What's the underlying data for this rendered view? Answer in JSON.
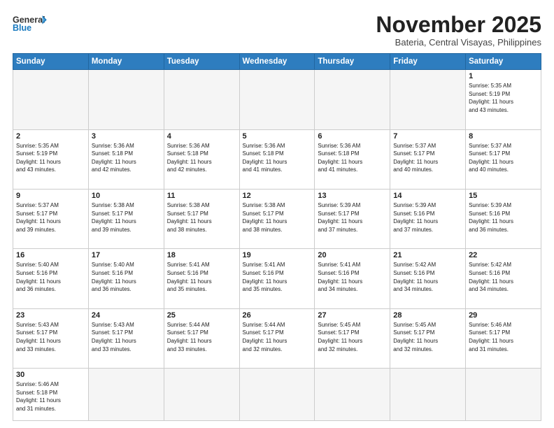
{
  "header": {
    "logo_general": "General",
    "logo_blue": "Blue",
    "month_title": "November 2025",
    "subtitle": "Bateria, Central Visayas, Philippines"
  },
  "days_of_week": [
    "Sunday",
    "Monday",
    "Tuesday",
    "Wednesday",
    "Thursday",
    "Friday",
    "Saturday"
  ],
  "weeks": [
    [
      {
        "day": "",
        "info": "",
        "empty": true
      },
      {
        "day": "",
        "info": "",
        "empty": true
      },
      {
        "day": "",
        "info": "",
        "empty": true
      },
      {
        "day": "",
        "info": "",
        "empty": true
      },
      {
        "day": "",
        "info": "",
        "empty": true
      },
      {
        "day": "",
        "info": "",
        "empty": true
      },
      {
        "day": "1",
        "info": "Sunrise: 5:35 AM\nSunset: 5:19 PM\nDaylight: 11 hours\nand 43 minutes."
      }
    ],
    [
      {
        "day": "2",
        "info": "Sunrise: 5:35 AM\nSunset: 5:19 PM\nDaylight: 11 hours\nand 43 minutes."
      },
      {
        "day": "3",
        "info": "Sunrise: 5:36 AM\nSunset: 5:18 PM\nDaylight: 11 hours\nand 42 minutes."
      },
      {
        "day": "4",
        "info": "Sunrise: 5:36 AM\nSunset: 5:18 PM\nDaylight: 11 hours\nand 42 minutes."
      },
      {
        "day": "5",
        "info": "Sunrise: 5:36 AM\nSunset: 5:18 PM\nDaylight: 11 hours\nand 41 minutes."
      },
      {
        "day": "6",
        "info": "Sunrise: 5:36 AM\nSunset: 5:18 PM\nDaylight: 11 hours\nand 41 minutes."
      },
      {
        "day": "7",
        "info": "Sunrise: 5:37 AM\nSunset: 5:17 PM\nDaylight: 11 hours\nand 40 minutes."
      },
      {
        "day": "8",
        "info": "Sunrise: 5:37 AM\nSunset: 5:17 PM\nDaylight: 11 hours\nand 40 minutes."
      }
    ],
    [
      {
        "day": "9",
        "info": "Sunrise: 5:37 AM\nSunset: 5:17 PM\nDaylight: 11 hours\nand 39 minutes."
      },
      {
        "day": "10",
        "info": "Sunrise: 5:38 AM\nSunset: 5:17 PM\nDaylight: 11 hours\nand 39 minutes."
      },
      {
        "day": "11",
        "info": "Sunrise: 5:38 AM\nSunset: 5:17 PM\nDaylight: 11 hours\nand 38 minutes."
      },
      {
        "day": "12",
        "info": "Sunrise: 5:38 AM\nSunset: 5:17 PM\nDaylight: 11 hours\nand 38 minutes."
      },
      {
        "day": "13",
        "info": "Sunrise: 5:39 AM\nSunset: 5:17 PM\nDaylight: 11 hours\nand 37 minutes."
      },
      {
        "day": "14",
        "info": "Sunrise: 5:39 AM\nSunset: 5:16 PM\nDaylight: 11 hours\nand 37 minutes."
      },
      {
        "day": "15",
        "info": "Sunrise: 5:39 AM\nSunset: 5:16 PM\nDaylight: 11 hours\nand 36 minutes."
      }
    ],
    [
      {
        "day": "16",
        "info": "Sunrise: 5:40 AM\nSunset: 5:16 PM\nDaylight: 11 hours\nand 36 minutes."
      },
      {
        "day": "17",
        "info": "Sunrise: 5:40 AM\nSunset: 5:16 PM\nDaylight: 11 hours\nand 36 minutes."
      },
      {
        "day": "18",
        "info": "Sunrise: 5:41 AM\nSunset: 5:16 PM\nDaylight: 11 hours\nand 35 minutes."
      },
      {
        "day": "19",
        "info": "Sunrise: 5:41 AM\nSunset: 5:16 PM\nDaylight: 11 hours\nand 35 minutes."
      },
      {
        "day": "20",
        "info": "Sunrise: 5:41 AM\nSunset: 5:16 PM\nDaylight: 11 hours\nand 34 minutes."
      },
      {
        "day": "21",
        "info": "Sunrise: 5:42 AM\nSunset: 5:16 PM\nDaylight: 11 hours\nand 34 minutes."
      },
      {
        "day": "22",
        "info": "Sunrise: 5:42 AM\nSunset: 5:16 PM\nDaylight: 11 hours\nand 34 minutes."
      }
    ],
    [
      {
        "day": "23",
        "info": "Sunrise: 5:43 AM\nSunset: 5:17 PM\nDaylight: 11 hours\nand 33 minutes."
      },
      {
        "day": "24",
        "info": "Sunrise: 5:43 AM\nSunset: 5:17 PM\nDaylight: 11 hours\nand 33 minutes."
      },
      {
        "day": "25",
        "info": "Sunrise: 5:44 AM\nSunset: 5:17 PM\nDaylight: 11 hours\nand 33 minutes."
      },
      {
        "day": "26",
        "info": "Sunrise: 5:44 AM\nSunset: 5:17 PM\nDaylight: 11 hours\nand 32 minutes."
      },
      {
        "day": "27",
        "info": "Sunrise: 5:45 AM\nSunset: 5:17 PM\nDaylight: 11 hours\nand 32 minutes."
      },
      {
        "day": "28",
        "info": "Sunrise: 5:45 AM\nSunset: 5:17 PM\nDaylight: 11 hours\nand 32 minutes."
      },
      {
        "day": "29",
        "info": "Sunrise: 5:46 AM\nSunset: 5:17 PM\nDaylight: 11 hours\nand 31 minutes."
      }
    ],
    [
      {
        "day": "30",
        "info": "Sunrise: 5:46 AM\nSunset: 5:18 PM\nDaylight: 11 hours\nand 31 minutes."
      },
      {
        "day": "",
        "info": "",
        "empty": true
      },
      {
        "day": "",
        "info": "",
        "empty": true
      },
      {
        "day": "",
        "info": "",
        "empty": true
      },
      {
        "day": "",
        "info": "",
        "empty": true
      },
      {
        "day": "",
        "info": "",
        "empty": true
      },
      {
        "day": "",
        "info": "",
        "empty": true
      }
    ]
  ]
}
